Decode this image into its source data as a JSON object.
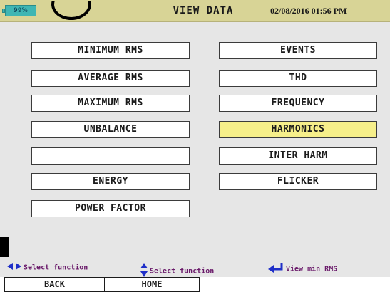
{
  "status_bar": {
    "battery_percent": "99%",
    "title": "VIEW DATA",
    "datetime": "02/08/2016 01:56 PM"
  },
  "functions": {
    "left": [
      "MINIMUM RMS",
      "AVERAGE RMS",
      "MAXIMUM RMS",
      "UNBALANCE",
      "",
      "ENERGY",
      "POWER FACTOR"
    ],
    "right": [
      "EVENTS",
      "THD",
      "FREQUENCY",
      "HARMONICS",
      "INTER HARM",
      "FLICKER"
    ],
    "selected": "HARMONICS"
  },
  "hints": {
    "left_right": "Select function",
    "up_down": "Select function",
    "enter": "View min RMS"
  },
  "softkeys": {
    "back": "BACK",
    "home": "HOME"
  },
  "colors": {
    "header": "#d8d496",
    "selected": "#f6ef8a",
    "hint_text": "#6a1a6a",
    "battery": "#3fb6b3"
  }
}
